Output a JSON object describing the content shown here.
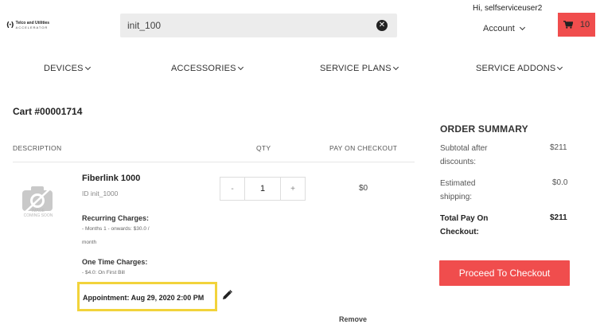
{
  "header": {
    "logo_mark": "(·)",
    "logo_line1": "Telco and Utilities",
    "logo_line2": "ACCELERATOR",
    "search_value": "init_100",
    "greeting": "Hi, selfserviceuser2",
    "account_label": "Account",
    "cart_count": "10",
    "accent_color": "#f04d4d"
  },
  "nav": {
    "devices": "DEVICES",
    "accessories": "ACCESSORIES",
    "service_plans": "SERVICE PLANS",
    "service_addons": "SERVICE ADDONS"
  },
  "cart": {
    "title": "Cart #00001714",
    "columns": {
      "description": "DESCRIPTION",
      "qty": "QTY",
      "pay": "PAY ON CHECKOUT"
    },
    "item": {
      "image_caption_1": "IMAGE",
      "image_caption_2": "COMING SOON",
      "name": "Fiberlink 1000",
      "id": "ID init_1000",
      "recurring_label": "Recurring Charges:",
      "recurring_line1": "- Months 1 - onwards: $30.0 /",
      "recurring_line2": "month",
      "onetime_label": "One Time Charges:",
      "onetime_line1": "- $4.0: On First Bill",
      "appointment": "Appointment: Aug 29, 2020 2:00 PM",
      "qty_minus": "-",
      "qty_value": "1",
      "qty_plus": "+",
      "pay_value": "$0",
      "remove_label": "Remove"
    }
  },
  "summary": {
    "title": "ORDER SUMMARY",
    "subtotal_label_1": "Subtotal after",
    "subtotal_label_2": "discounts:",
    "subtotal_value": "$211",
    "shipping_label_1": "Estimated",
    "shipping_label_2": "shipping:",
    "shipping_value": "$0.0",
    "total_label_1": "Total Pay On",
    "total_label_2": "Checkout:",
    "total_value": "$211",
    "checkout_label": "Proceed To Checkout"
  }
}
